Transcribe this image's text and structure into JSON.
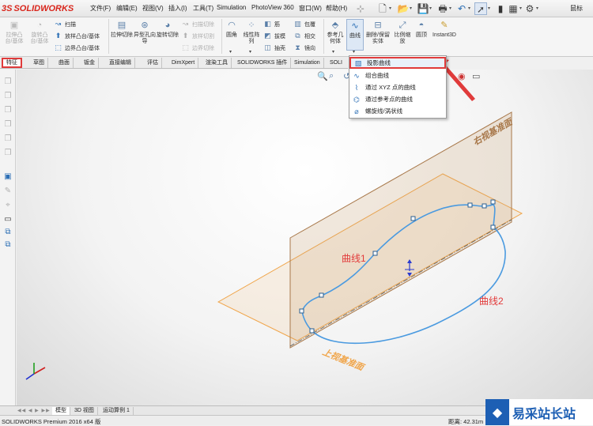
{
  "app": {
    "logo_text": "SOLIDWORKS",
    "logo_mark": "3S"
  },
  "menu": {
    "items": [
      "文件(F)",
      "编辑(E)",
      "视图(V)",
      "插入(I)",
      "工具(T)",
      "Simulation",
      "PhotoView 360",
      "窗口(W)",
      "帮助(H)"
    ],
    "pin": "⊹",
    "search_label": "鼠标"
  },
  "ribbon": {
    "extrude_boss": "拉伸凸台/基体",
    "revolve_boss": "旋转凸台/基体",
    "sweep": "扫描",
    "loft_boss": "放样凸台/基体",
    "boundary_boss": "边界凸台/基体",
    "extrude_cut": "拉伸切除",
    "hole_wizard": "异型孔向导",
    "revolve_cut": "旋转切除",
    "sweep_cut": "扫描切除",
    "loft_cut": "放样切割",
    "boundary_cut": "边界切除",
    "fillet": "圆角",
    "linear_pattern": "线性阵列",
    "rib": "筋",
    "draft": "拔模",
    "shell": "抽壳",
    "wrap": "包覆",
    "intersect": "相交",
    "mirror": "镜向",
    "reference_geometry": "参考几何体",
    "curves": "曲线",
    "delete_keep_body": "删除/保留实体",
    "scale": "比例缩放",
    "dome": "圆顶",
    "instant3d": "Instant3D"
  },
  "tabs": [
    "特征",
    "草图",
    "曲面",
    "钣金",
    "直接编辑",
    "评估",
    "DimXpert",
    "渲染工具",
    "SOLIDWORKS 插件",
    "Simulation",
    "SOLI"
  ],
  "dropdown": {
    "items": [
      {
        "label": "投影曲线",
        "icon": "projected-curve-icon"
      },
      {
        "label": "组合曲线",
        "icon": "composite-curve-icon"
      },
      {
        "label": "通过 XYZ 点的曲线",
        "icon": "curve-through-xyz-icon"
      },
      {
        "label": "通过参考点的曲线",
        "icon": "curve-through-reference-points-icon"
      },
      {
        "label": "螺旋线/涡状线",
        "icon": "helix-spiral-icon"
      }
    ]
  },
  "scene": {
    "right_plane_label": "右视基准面",
    "top_plane_label": "上视基准面",
    "curve1_label": "曲线1",
    "curve2_label": "曲线2"
  },
  "bottom_tabs": [
    "模型",
    "3D 视图",
    "运动算例 1"
  ],
  "status": {
    "version": "SOLIDWORKS Premium 2016 x64 版",
    "distance": "距离: 42.31m"
  },
  "watermark": {
    "text": "易采站长站"
  },
  "colors": {
    "accent_red": "#e03b3b",
    "plane_orange": "#f0a54a",
    "plane_brown": "#a8784a",
    "curve_blue": "#4a9ae0",
    "label_red": "#e23a3a"
  }
}
